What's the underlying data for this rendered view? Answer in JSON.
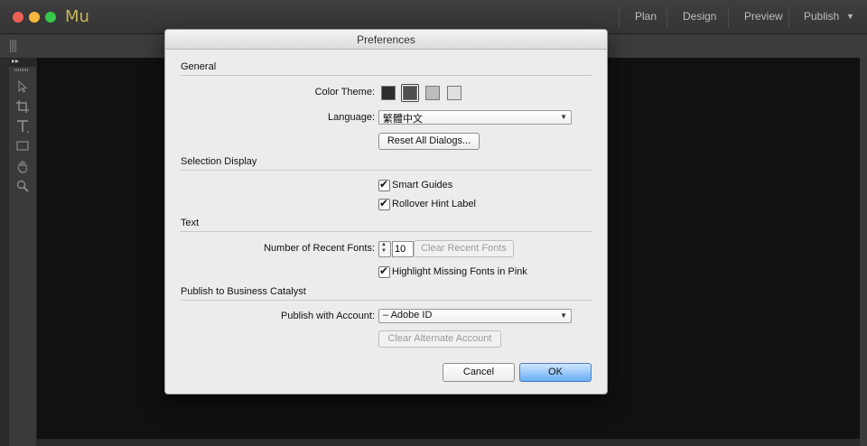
{
  "app": {
    "logo": "Mu"
  },
  "modes": [
    {
      "label": "Plan"
    },
    {
      "label": "Design"
    },
    {
      "label": "Preview"
    },
    {
      "label": "Publish"
    }
  ],
  "dialog": {
    "title": "Preferences",
    "general": {
      "title": "General",
      "color_theme_label": "Color Theme:",
      "swatch_colors": [
        "#2d2d2d",
        "#505050",
        "#bdbdbd",
        "#e0e0e0"
      ],
      "selected_swatch_index": 1,
      "language_label": "Language:",
      "language_value": "繁體中文",
      "reset_button": "Reset All Dialogs..."
    },
    "selection_display": {
      "title": "Selection Display",
      "smart_guides_label": "Smart Guides",
      "smart_guides_checked": true,
      "rollover_label": "Rollover Hint Label",
      "rollover_checked": true
    },
    "text": {
      "title": "Text",
      "recent_fonts_label": "Number of Recent Fonts:",
      "recent_fonts_value": "10",
      "clear_recent_button": "Clear Recent Fonts",
      "highlight_missing_label": "Highlight Missing Fonts in Pink",
      "highlight_missing_checked": true
    },
    "publish": {
      "title": "Publish to Business Catalyst",
      "account_label": "Publish with Account:",
      "account_value": "– Adobe ID",
      "clear_alternate_button": "Clear Alternate Account"
    },
    "cancel_button": "Cancel",
    "ok_button": "OK"
  },
  "icons": {
    "tools": [
      "selection-arrow-icon",
      "crop-icon",
      "text-tool-icon",
      "rectangle-tool-icon",
      "hand-tool-icon",
      "zoom-tool-icon"
    ]
  }
}
